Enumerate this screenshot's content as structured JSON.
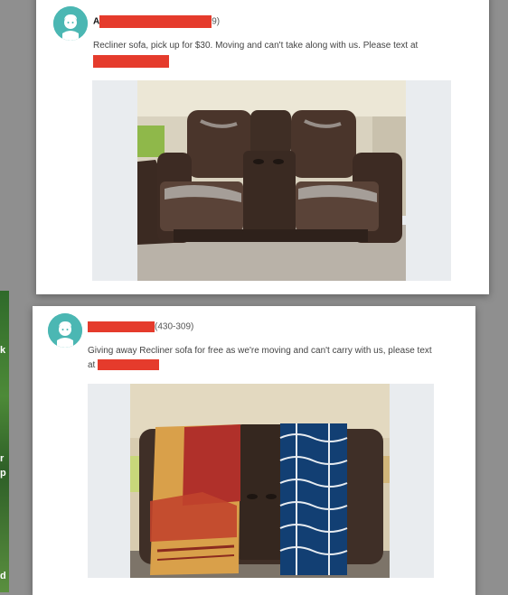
{
  "sidebar": {
    "partial_labels": [
      "k",
      "r",
      "p",
      "p",
      "d"
    ]
  },
  "posts": [
    {
      "name_initial": "A",
      "phone_suffix": "9)",
      "message": "Recliner sofa, pick up for $30. Moving and can't take along with us. Please text at",
      "message_continuation_prefix": "",
      "photo_icon": "recliner-sofa-photo"
    },
    {
      "name_initial": "",
      "phone_suffix": "(430-309)",
      "message": "Giving away Recliner sofa for free as we're moving and can't carry with us, please text",
      "message_continuation_prefix": "at",
      "photo_icon": "covered-recliner-sofa-photo"
    }
  ],
  "colors": {
    "redaction": "#e53b2c",
    "avatar": "#4bb7b3"
  }
}
